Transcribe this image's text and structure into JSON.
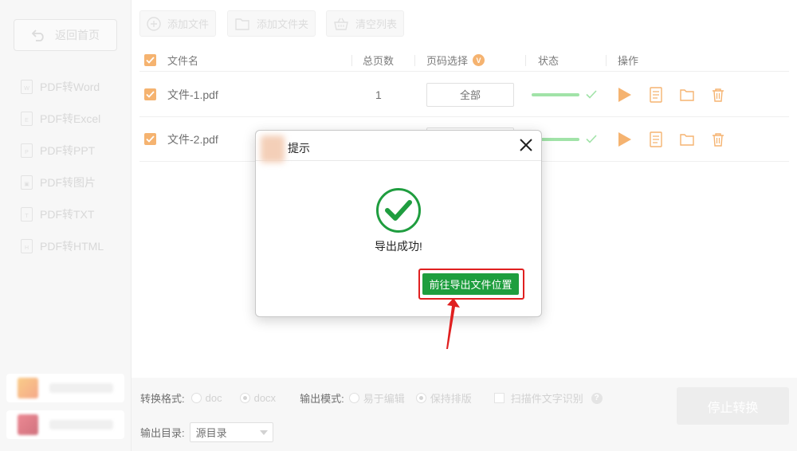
{
  "sidebar": {
    "back_label": "返回首页",
    "items": [
      {
        "label": "PDF转Word",
        "icon_letter": "W"
      },
      {
        "label": "PDF转Excel",
        "icon_letter": "E"
      },
      {
        "label": "PDF转PPT",
        "icon_letter": "P"
      },
      {
        "label": "PDF转图片",
        "icon_letter": "▣"
      },
      {
        "label": "PDF转TXT",
        "icon_letter": "T"
      },
      {
        "label": "PDF转HTML",
        "icon_letter": "H"
      }
    ]
  },
  "toolbar": {
    "add_file": "添加文件",
    "add_folder": "添加文件夹",
    "clear_list": "清空列表"
  },
  "table": {
    "headers": {
      "name": "文件名",
      "pages": "总页数",
      "page_select": "页码选择",
      "page_select_badge": "V",
      "status": "状态",
      "actions": "操作"
    },
    "rows": [
      {
        "name": "文件-1.pdf",
        "pages": "1",
        "range": "全部",
        "progress": 1.0
      },
      {
        "name": "文件-2.pdf",
        "pages": "",
        "range": "",
        "progress": 1.0
      }
    ]
  },
  "bottom": {
    "format_label": "转换格式:",
    "format_options": [
      "doc",
      "docx"
    ],
    "format_selected": "docx",
    "mode_label": "输出模式:",
    "mode_options": [
      "易于编辑",
      "保持排版"
    ],
    "mode_selected": "保持排版",
    "ocr_label": "扫描件文字识别",
    "ocr_help": "?",
    "dir_label": "输出目录:",
    "dir_value": "源目录",
    "stop_label": "停止转换"
  },
  "dialog": {
    "title": "提示",
    "message": "导出成功!",
    "button_label": "前往导出文件位置"
  },
  "colors": {
    "accent_orange": "#f08a24",
    "success_green": "#1e9e3e",
    "progress_green": "#6fd47a",
    "highlight_red": "#e02020"
  }
}
